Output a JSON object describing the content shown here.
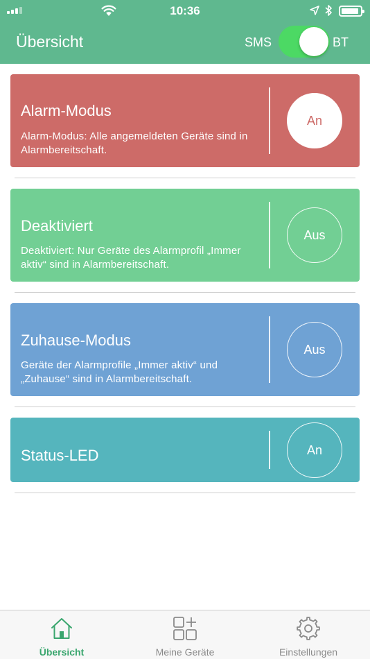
{
  "status_bar": {
    "time": "10:36"
  },
  "header": {
    "title": "Übersicht",
    "sms_label": "SMS",
    "bt_label": "BT",
    "mode_toggle_on": true
  },
  "cards": [
    {
      "title": "Alarm-Modus",
      "description": "Alarm-Modus: Alle angemeldeten Geräte sind in Alarmbereitschaft.",
      "button_label": "An",
      "button_active": true,
      "color": "#cd6b68"
    },
    {
      "title": "Deaktiviert",
      "description": "Deaktiviert: Nur Geräte des Alarmprofil „Immer aktiv“ sind in Alarmbereitschaft.",
      "button_label": "Aus",
      "button_active": false,
      "color": "#72cf94"
    },
    {
      "title": "Zuhause-Modus",
      "description": "Geräte der Alarmprofile „Immer aktiv“ und „Zuhause“ sind in Alarmbereitschaft.",
      "button_label": "Aus",
      "button_active": false,
      "color": "#6fa2d4"
    },
    {
      "title": "Status-LED",
      "button_label": "An",
      "button_active": false,
      "color": "#55b5bd"
    }
  ],
  "tabbar": {
    "active_color": "#3aa66e",
    "inactive_color": "#8a8a8a",
    "items": [
      {
        "label": "Übersicht",
        "icon": "home-icon",
        "active": true
      },
      {
        "label": "Meine Geräte",
        "icon": "devices-grid-icon",
        "active": false
      },
      {
        "label": "Einstellungen",
        "icon": "settings-gear-icon",
        "active": false
      }
    ]
  }
}
